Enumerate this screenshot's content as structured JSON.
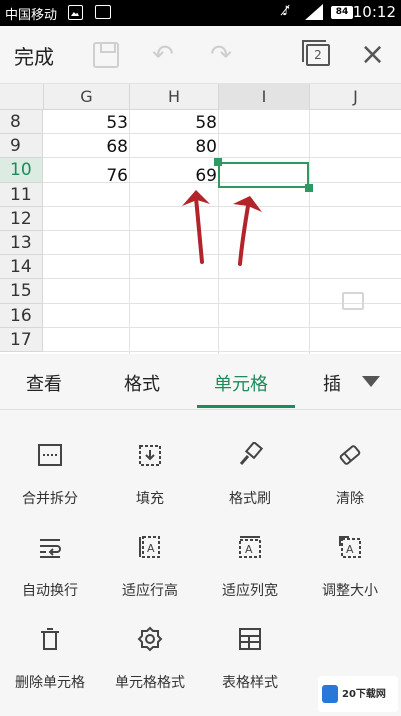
{
  "status_bar": {
    "carrier": "中国移动",
    "battery": "84",
    "time": "10:12"
  },
  "toolbar": {
    "done_label": "完成",
    "pages_count": "2"
  },
  "sheet": {
    "columns": [
      "G",
      "H",
      "I",
      "J"
    ],
    "selected_column": "I",
    "rows": [
      "8",
      "9",
      "10",
      "11",
      "12",
      "13",
      "14",
      "15",
      "16",
      "17"
    ],
    "active_row": "10",
    "cells": {
      "G8": "53",
      "H8": "58",
      "G9": "68",
      "H9": "80",
      "G10": "76",
      "H10": "69"
    },
    "accent_color": "#2d9a63",
    "arrow_color": "#b2232a"
  },
  "tabs": {
    "items": [
      "查看",
      "格式",
      "单元格",
      "插"
    ],
    "active": "单元格"
  },
  "tools": [
    {
      "label": "合并拆分",
      "icon": "merge-split-icon"
    },
    {
      "label": "填充",
      "icon": "fill-icon"
    },
    {
      "label": "格式刷",
      "icon": "format-brush-icon"
    },
    {
      "label": "清除",
      "icon": "eraser-icon"
    },
    {
      "label": "自动换行",
      "icon": "wrap-text-icon"
    },
    {
      "label": "适应行高",
      "icon": "fit-row-height-icon"
    },
    {
      "label": "适应列宽",
      "icon": "fit-column-width-icon"
    },
    {
      "label": "调整大小",
      "icon": "resize-icon"
    },
    {
      "label": "删除单元格",
      "icon": "delete-cell-icon"
    },
    {
      "label": "单元格格式",
      "icon": "cell-format-gear-icon"
    },
    {
      "label": "表格样式",
      "icon": "table-style-icon"
    }
  ],
  "watermark": {
    "text": "20下载网"
  }
}
